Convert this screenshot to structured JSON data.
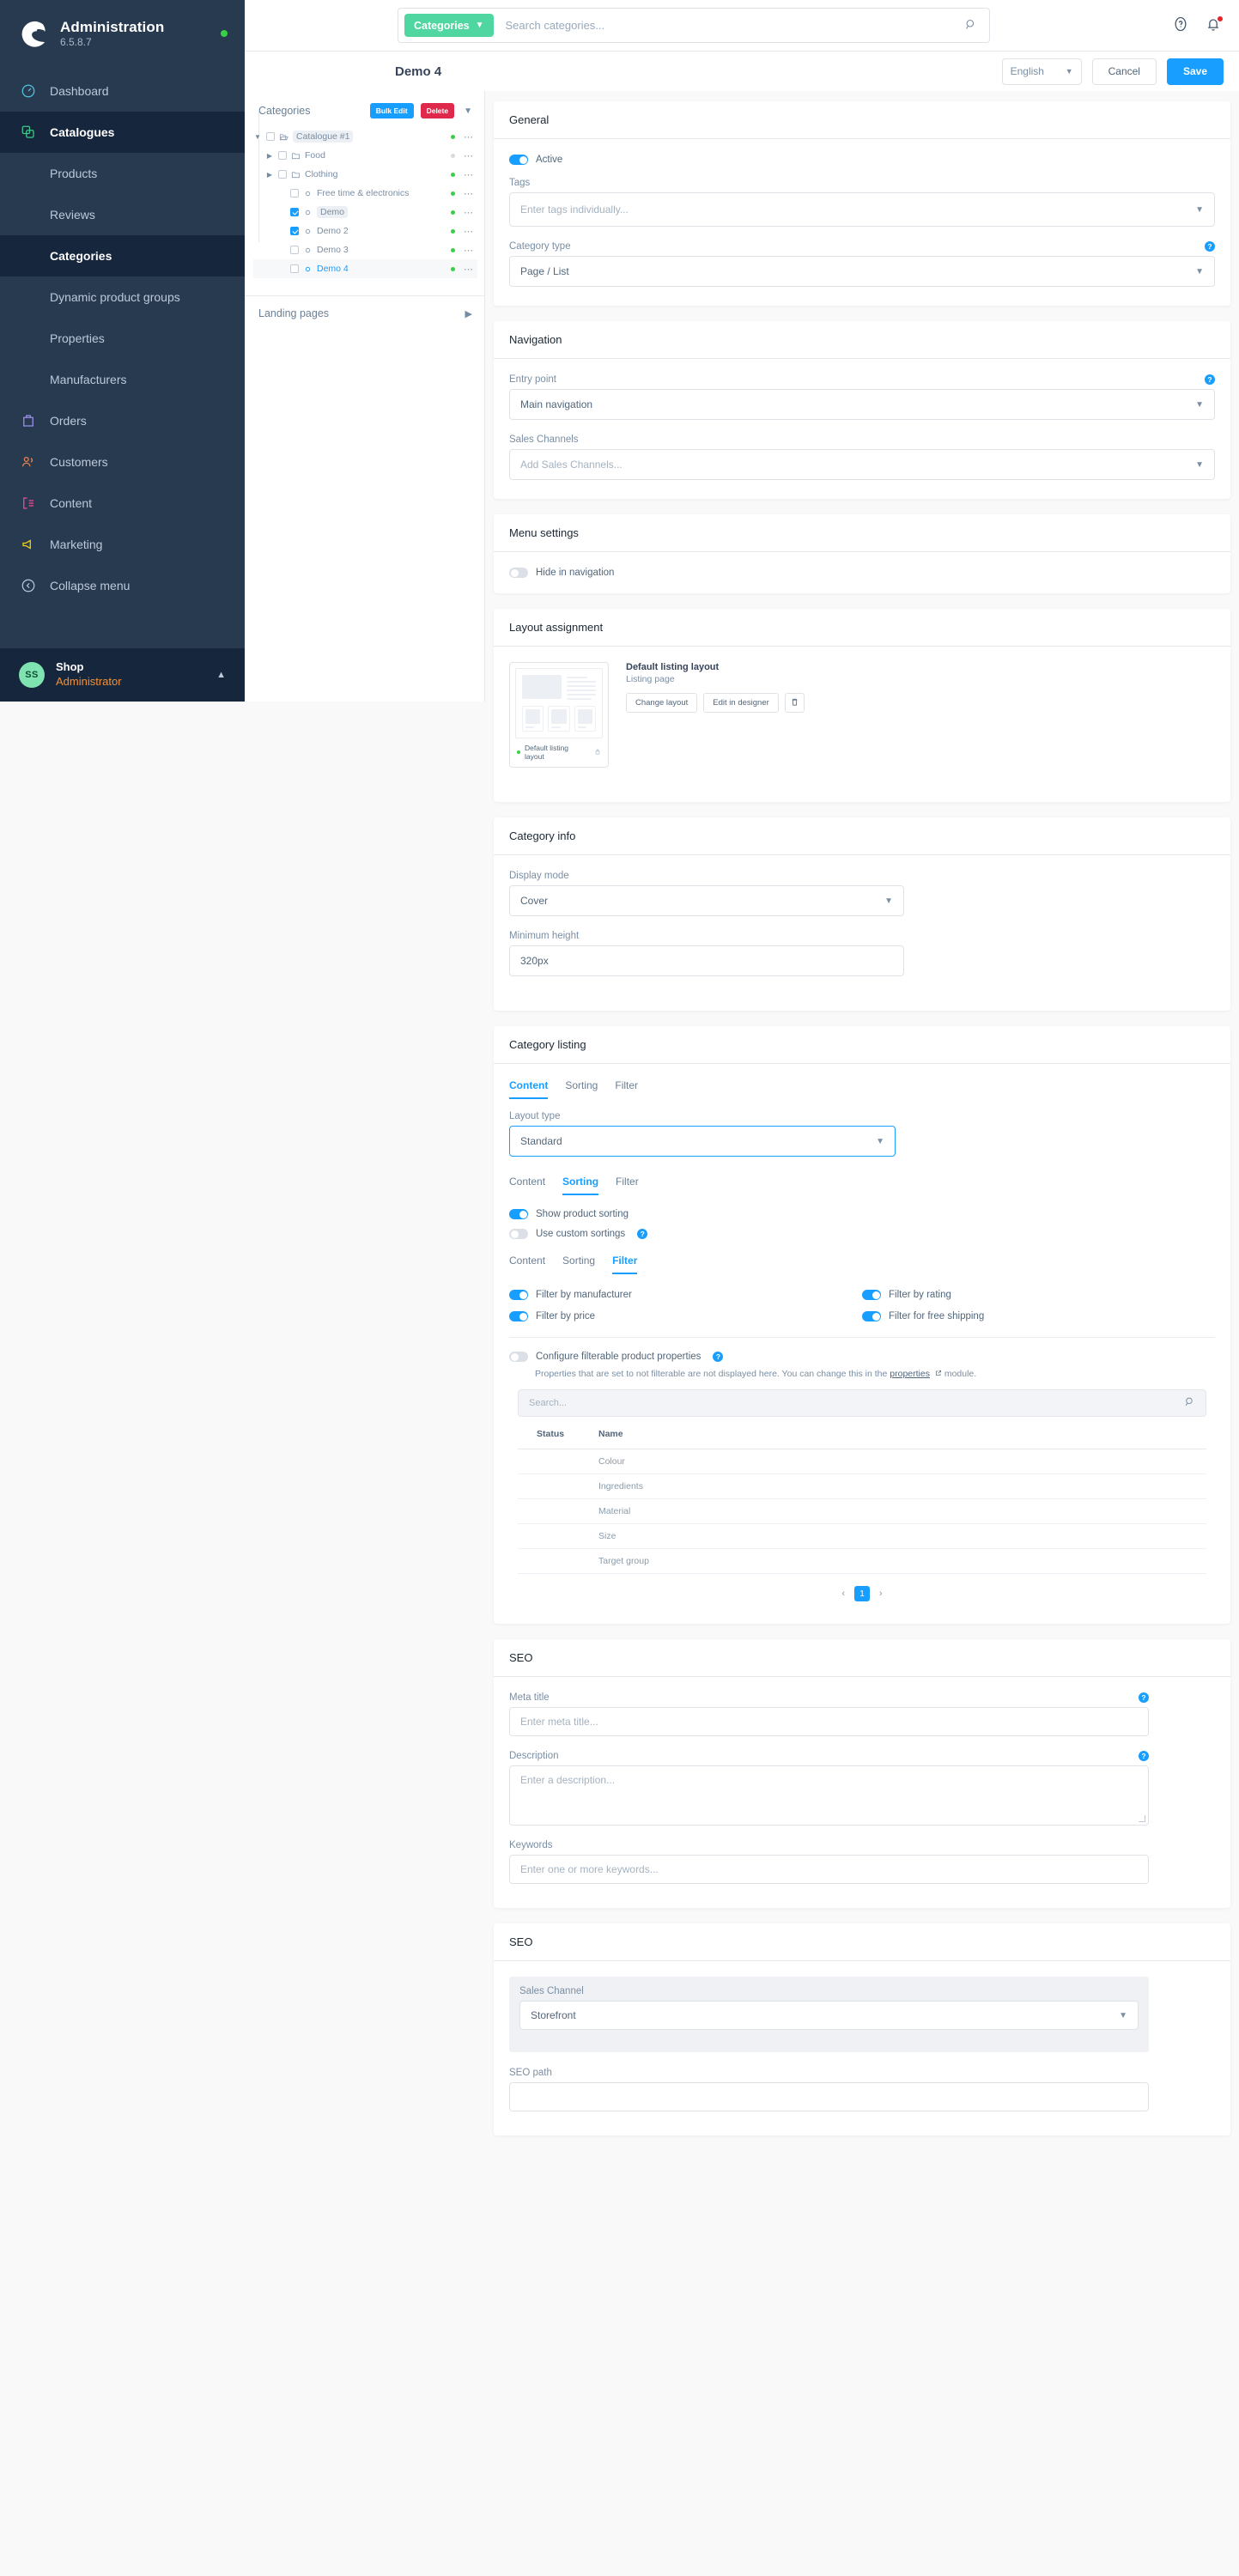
{
  "sidebar": {
    "brand": {
      "title": "Administration",
      "version": "6.5.8.7",
      "logo_icon": "shopware-logo-icon",
      "status_dot": "online-status-dot"
    },
    "items": [
      {
        "label": "Dashboard",
        "icon": "dashboard-icon",
        "active": false,
        "sub": false
      },
      {
        "label": "Catalogues",
        "icon": "catalogues-icon",
        "active": true,
        "sub": false
      },
      {
        "label": "Products",
        "icon": "",
        "active": false,
        "sub": true
      },
      {
        "label": "Reviews",
        "icon": "",
        "active": false,
        "sub": true
      },
      {
        "label": "Categories",
        "icon": "",
        "active": true,
        "sub": true
      },
      {
        "label": "Dynamic product groups",
        "icon": "",
        "active": false,
        "sub": true
      },
      {
        "label": "Properties",
        "icon": "",
        "active": false,
        "sub": true
      },
      {
        "label": "Manufacturers",
        "icon": "",
        "active": false,
        "sub": true
      },
      {
        "label": "Orders",
        "icon": "orders-icon",
        "active": false,
        "sub": false
      },
      {
        "label": "Customers",
        "icon": "customers-icon",
        "active": false,
        "sub": false
      },
      {
        "label": "Content",
        "icon": "content-icon",
        "active": false,
        "sub": false
      },
      {
        "label": "Marketing",
        "icon": "marketing-icon",
        "active": false,
        "sub": false
      },
      {
        "label": "Collapse menu",
        "icon": "collapse-menu-icon",
        "active": false,
        "sub": false
      }
    ],
    "user": {
      "initials": "SS",
      "name": "Shop",
      "role": "Administrator"
    }
  },
  "topbar": {
    "scope_label": "Categories",
    "search_placeholder": "Search categories...",
    "search_value": "",
    "help_icon": "help-icon",
    "notifications_icon": "bell-icon"
  },
  "page_header": {
    "title": "Demo 4",
    "language": "English",
    "cancel_label": "Cancel",
    "save_label": "Save"
  },
  "tree": {
    "header_label": "Categories",
    "bulk_edit_label": "Bulk Edit",
    "delete_label": "Delete",
    "rows": [
      {
        "label": "Catalogue #1",
        "depth": 0,
        "expanded": true,
        "arrow": "down",
        "checked": false,
        "icon": "folder-open-icon",
        "active_status": true,
        "pill": true,
        "selected": false,
        "highlight": false
      },
      {
        "label": "Food",
        "depth": 1,
        "expanded": false,
        "arrow": "right",
        "checked": false,
        "icon": "folder-icon",
        "active_status": false,
        "pill": false,
        "selected": false,
        "highlight": false
      },
      {
        "label": "Clothing",
        "depth": 1,
        "expanded": false,
        "arrow": "right",
        "checked": false,
        "icon": "folder-icon",
        "active_status": true,
        "pill": false,
        "selected": false,
        "highlight": false
      },
      {
        "label": "Free time & electronics",
        "depth": 2,
        "expanded": false,
        "arrow": "none",
        "checked": false,
        "icon": "leaf-icon",
        "active_status": true,
        "pill": false,
        "selected": false,
        "highlight": false
      },
      {
        "label": "Demo",
        "depth": 2,
        "expanded": false,
        "arrow": "none",
        "checked": true,
        "icon": "leaf-icon",
        "active_status": true,
        "pill": true,
        "selected": false,
        "highlight": false
      },
      {
        "label": "Demo 2",
        "depth": 2,
        "expanded": false,
        "arrow": "none",
        "checked": true,
        "icon": "leaf-icon",
        "active_status": true,
        "pill": false,
        "selected": false,
        "highlight": false
      },
      {
        "label": "Demo 3",
        "depth": 2,
        "expanded": false,
        "arrow": "none",
        "checked": false,
        "icon": "leaf-icon",
        "active_status": true,
        "pill": false,
        "selected": false,
        "highlight": false
      },
      {
        "label": "Demo 4",
        "depth": 2,
        "expanded": false,
        "arrow": "none",
        "checked": false,
        "icon": "leaf-icon",
        "active_status": true,
        "pill": false,
        "selected": true,
        "highlight": true
      }
    ],
    "landing_pages_label": "Landing pages"
  },
  "general": {
    "title": "General",
    "active_label": "Active",
    "active_on": true,
    "tags_label": "Tags",
    "tags_placeholder": "Enter tags individually...",
    "category_type_label": "Category type",
    "category_type_value": "Page / List"
  },
  "navigation": {
    "title": "Navigation",
    "entry_point_label": "Entry point",
    "entry_point_value": "Main navigation",
    "sales_channels_label": "Sales Channels",
    "sales_channels_placeholder": "Add Sales Channels..."
  },
  "menu_settings": {
    "title": "Menu settings",
    "hide_in_navigation_label": "Hide in navigation",
    "hide_in_navigation_on": false
  },
  "layout_assignment": {
    "title": "Layout assignment",
    "thumb_label": "Default listing layout",
    "name": "Default listing layout",
    "sub": "Listing page",
    "change_layout_label": "Change layout",
    "edit_in_designer_label": "Edit in designer",
    "delete_icon": "trash-icon",
    "lock_icon": "lock-icon"
  },
  "category_info": {
    "title": "Category info",
    "display_mode_label": "Display mode",
    "display_mode_value": "Cover",
    "minimum_height_label": "Minimum height",
    "minimum_height_value": "320px"
  },
  "category_listing": {
    "title": "Category listing",
    "tabs_content": [
      {
        "label": "Content",
        "active": true
      },
      {
        "label": "Sorting",
        "active": false
      },
      {
        "label": "Filter",
        "active": false
      }
    ],
    "layout_type_label": "Layout type",
    "layout_type_value": "Standard",
    "tabs_sorting": [
      {
        "label": "Content",
        "active": false
      },
      {
        "label": "Sorting",
        "active": true
      },
      {
        "label": "Filter",
        "active": false
      }
    ],
    "show_product_sorting_label": "Show product sorting",
    "show_product_sorting_on": true,
    "use_custom_sortings_label": "Use custom sortings",
    "use_custom_sortings_on": false,
    "tabs_filter": [
      {
        "label": "Content",
        "active": false
      },
      {
        "label": "Sorting",
        "active": false
      },
      {
        "label": "Filter",
        "active": true
      }
    ],
    "filter_toggles": [
      {
        "label": "Filter by manufacturer",
        "on": true
      },
      {
        "label": "Filter by rating",
        "on": true
      },
      {
        "label": "Filter by price",
        "on": true
      },
      {
        "label": "Filter for free shipping",
        "on": true
      }
    ],
    "configure_filterable_label": "Configure filterable product properties",
    "configure_filterable_on": false,
    "hint_before": "Properties that are set to not filterable are not displayed here. You can change this in the ",
    "hint_link": "properties",
    "hint_after": " module.",
    "external_link_icon": "external-link-icon",
    "properties_search_placeholder": "Search...",
    "properties_columns": [
      "Status",
      "Name"
    ],
    "properties_rows": [
      {
        "name": "Colour",
        "status_on": true
      },
      {
        "name": "Ingredients",
        "status_on": true
      },
      {
        "name": "Material",
        "status_on": true
      },
      {
        "name": "Size",
        "status_on": true
      },
      {
        "name": "Target group",
        "status_on": true
      }
    ],
    "pagination": {
      "prev": "‹",
      "page": "1",
      "next": "›"
    }
  },
  "seo_meta": {
    "title": "SEO",
    "meta_title_label": "Meta title",
    "meta_title_placeholder": "Enter meta title...",
    "description_label": "Description",
    "description_placeholder": "Enter a description...",
    "keywords_label": "Keywords",
    "keywords_placeholder": "Enter one or more keywords..."
  },
  "seo_path": {
    "title": "SEO",
    "sales_channel_label": "Sales Channel",
    "sales_channel_value": "Storefront",
    "seo_path_label": "SEO path",
    "seo_path_value": ""
  },
  "colors": {
    "accent_blue": "#189eff",
    "brand_green": "#50d6a0",
    "danger_red": "#de294c",
    "sidebar_bg": "#283a50",
    "status_green": "#37d046",
    "role_orange": "#f0913b"
  }
}
